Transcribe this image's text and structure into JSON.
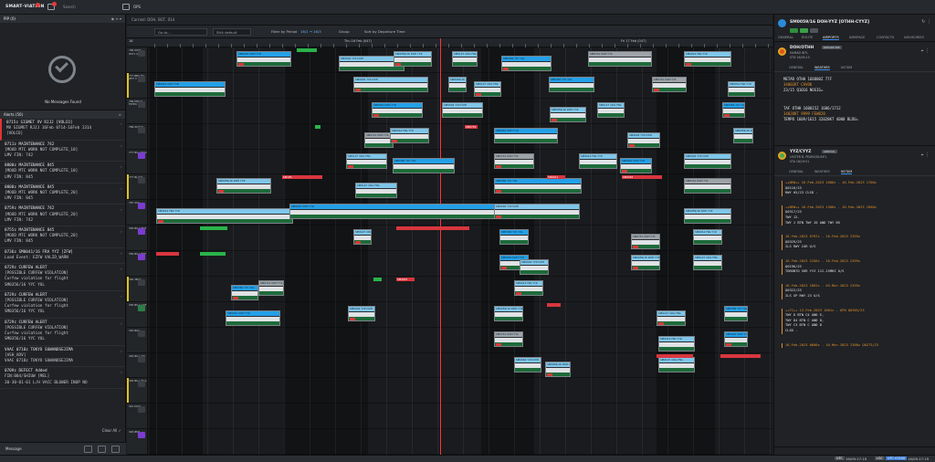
{
  "app": {
    "brand": "SMART∙VIATION",
    "search_label": "Search",
    "workspace_tab": "OPS"
  },
  "left": {
    "pip_title": "PIP (0)",
    "no_messages": "No Messages Found",
    "alerts_title": "Alerts (50)",
    "alerts": [
      {
        "title": "0715z SIGMET VV RJJJ [VOLCO]",
        "lines": [
          "MV SIGMET RJJJ 16Feb 0714-16Feb 1314",
          "[VOLCO]"
        ],
        "flag": "red"
      },
      {
        "title": "0711z MAINTENANCE 742",
        "lines": [
          "[MOOD MTC WORK NOT COMPLETE_10]",
          "LMV FIN: 742"
        ],
        "flag": ""
      },
      {
        "title": "0800z MAINTENANCE 845",
        "lines": [
          "[MOOD MTC WORK NOT COMPLETE_10]",
          "LMV FIN: 845"
        ],
        "flag": ""
      },
      {
        "title": "0800z MAINTENANCE 845",
        "lines": [
          "[MOOD MTC WORK NOT COMPLETE_20]",
          "LMV FIN: 845"
        ],
        "flag": ""
      },
      {
        "title": "0759z MAINTENANCE 742",
        "lines": [
          "[MOOD MTC WORK NOT COMPLETE_20]",
          "LMV FIN: 742"
        ],
        "flag": ""
      },
      {
        "title": "0755z MAINTENANCE 845",
        "lines": [
          "[MOOD MTC WORK NOT COMPLETE_20]",
          "LMV FIN: 845"
        ],
        "flag": ""
      },
      {
        "title": "0736z SM0041/16 FRA YYZ [ZFW]",
        "lines": [
          "Load Event: EZFW VALID_WARN"
        ],
        "flag": ""
      },
      {
        "title": "0729z CURFEW ALERT",
        "lines": [
          "[POSSIBLE CURFEW VIOLATION]",
          "Curfew violation for flight",
          "SM0356/16 YYC YUL"
        ],
        "flag": ""
      },
      {
        "title": "0729z CURFEW ALERT",
        "lines": [
          "[POSSIBLE CURFEW VIOLATION]",
          "Curfew violation for flight",
          "SM0356/16 YYC YUL"
        ],
        "flag": ""
      },
      {
        "title": "0729z CURFEW ALERT",
        "lines": [
          "[POSSIBLE CURFEW VIOLATION]",
          "Curfew violation for flight",
          "SM0356/16 YYC YUL"
        ],
        "flag": ""
      },
      {
        "title": "VAAC 0718z TOKYO SUWANOSEJIMA",
        "lines": [
          "[ASH_ADV]",
          "VAAC 0718z TOKYO SUWANOSEJIMA"
        ],
        "flag": ""
      },
      {
        "title": "0709z DEFECT Added",
        "lines": [
          "FIN:004/SHIUW [MEL]",
          "30-30-01-01 L/H VACC BLOWER INOP NO"
        ],
        "flag": ""
      }
    ],
    "clear_all": "Clear All",
    "footer_label": "Message"
  },
  "gantt": {
    "crumb": "Carried: DOH, BGT, 014",
    "goto_placeholder": "Go to...",
    "sha_label": "SHA default",
    "filter_label": "Filter by Period",
    "filter_chip": "16/1 → 16/3",
    "group_label": "Group",
    "sort_label": "Sort by Departure Time",
    "days": [
      "16",
      "Thu 16 Feb (047)",
      "Fri 17 Feb (047)"
    ],
    "rows": [
      {
        "reg": "789 0003 0071 4RB",
        "btn": ""
      },
      {
        "reg": "777 BBLUTY JETT 3",
        "btn": ""
      },
      {
        "reg": "789 MW17 FKTPO",
        "btn": ""
      },
      {
        "reg": "789 0C0CD",
        "btn": ""
      },
      {
        "reg": "777 BS-A EGG",
        "btn": "pur"
      },
      {
        "reg": "777 BLLDT",
        "btn": ""
      },
      {
        "reg": "787 SSC",
        "btn": "pur"
      },
      {
        "reg": "330 BS-A BGF",
        "btn": "pur"
      },
      {
        "reg": "330 BS-A BXF",
        "btn": "pur"
      },
      {
        "reg": "330 3BLP",
        "btn": ""
      },
      {
        "reg": "330 BS-A GRF",
        "btn": "grn"
      },
      {
        "reg": "320 BGT",
        "btn": ""
      },
      {
        "reg": "320 BS-A YPI",
        "btn": ""
      },
      {
        "reg": "320 BS-A BGA",
        "btn": ""
      },
      {
        "reg": "321 DOH",
        "btn": ""
      },
      {
        "reg": "320 BMA",
        "btn": "pur"
      }
    ],
    "flights": [
      {
        "label": "SM0001 DOH YYZ",
        "band": "blue"
      },
      {
        "label": "SM0004 YYZ DOH",
        "band": "light"
      },
      {
        "label": "SM0059/16 DOH YYZ",
        "band": "light"
      },
      {
        "label": "SM0127 CDG FRA",
        "band": "light"
      },
      {
        "label": "SM0356 YYC YUL",
        "band": "blue"
      },
      {
        "label": "SM0741 DOH YYC",
        "band": "gray"
      },
      {
        "label": "SM0014 FRA YYZ",
        "band": "light"
      }
    ],
    "bars": [
      "SM1/FL",
      "SM6011",
      "SM0045",
      "SM0731",
      "SM4007"
    ]
  },
  "right": {
    "flight_title": "SM0059/16 DOH-YYZ [OTHH-CYYZ]",
    "tabs": [
      "GENERAL",
      "ROUTE",
      "AIRPORTS",
      "AIRSPACE",
      "CONTACTS",
      "ADVISORIES"
    ],
    "active_tab": "AIRPORTS",
    "origin": {
      "code": "DOH/OTHH",
      "tag": "DEPARTURE",
      "name": "HAMAD INTL",
      "sub": "STD 16/05:15",
      "tabs": [
        "GENERAL",
        "WEATHER",
        "NOTAM"
      ],
      "metar": "METAR OTHH 160800Z 77F",
      "metar2": "34002KT CAVOK",
      "metar3": "23/15 Q1016 NOSIG=",
      "taf": "TAF OTHH 160015Z 1606/1712",
      "taf2": "34020KT 9999 FEW020",
      "taf3": "TEMPO 1609/1615 32020KT 4000 BLDU="
    },
    "dest": {
      "code": "YYZ/CYYZ",
      "tag": "ARRIVAL",
      "name": "LESTER B. PEARSON INTL",
      "sub": "STA 16/19:01",
      "tabs": [
        "GENERAL",
        "WEATHER",
        "NOTAM"
      ],
      "notams": [
        {
          "head": "++NEW++ 16.Feb.2023 1600z - 16.Feb.2023 1700z",
          "body": [
            "Q0116/23",
            "RWY 05/23 CLSD ."
          ]
        },
        {
          "head": "++NEW++ 16.Feb.2023 1300z - 16.Feb.2023 1900z",
          "body": [
            "Q0317/23",
            "TWY J2.",
            "TWY J BTN TWY J0 AND TWY B5"
          ]
        },
        {
          "head": "16.Feb.2023 0707z - 16.Feb.2023 2359z",
          "body": [
            "Q0329/23",
            "ILS RWY 24R U/S"
          ]
        },
        {
          "head": "16.Feb.2023 2156z - 16.Feb.2023 2359z",
          "body": [
            "Q0196/23",
            "TORONTO VOR YYZ 112.15MHZ U/S"
          ]
        },
        {
          "head": "16.Feb.2023 1801z - 03.Mar.2023 2359z",
          "body": [
            "Q0322/23",
            "ILS GP RWY 23 U/S"
          ]
        },
        {
          "head": "++TC++ 13.Feb.2023 1601z - UFN Q0305/23",
          "body": [
            "TWY D BTN C4 AND E,",
            "TWY D4 BTN C AND D,",
            "TWY C3 BTN C AND D",
            "CLSD ."
          ]
        },
        {
          "head": "16.Feb.2023 0600z - 10.Mar.2023 2300z Q0273/23",
          "body": []
        }
      ]
    }
  },
  "status": {
    "utc_label": "UTC",
    "utc_value": "16/09:17:19",
    "loc_label": "LOC",
    "loc_value": "UTC+03:00",
    "loc_time": "16/09:17:19"
  }
}
